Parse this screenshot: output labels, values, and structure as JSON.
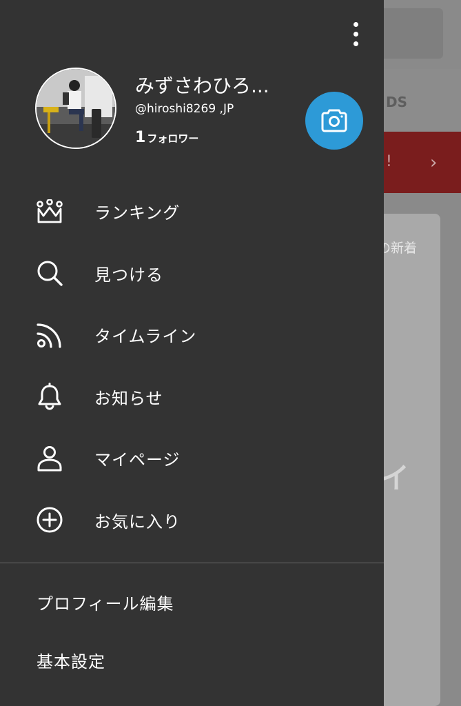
{
  "background": {
    "tab_label": "DS",
    "banner_text": "!",
    "card_text": "の新着",
    "card_big_text": "イ"
  },
  "drawer": {
    "user": {
      "name": "みずさわひろ...",
      "handle": "@hiroshi8269 ,JP",
      "follower_count": "1",
      "follower_label": "フォロワー"
    },
    "menu": [
      {
        "label": "ランキング",
        "icon": "crown-icon"
      },
      {
        "label": "見つける",
        "icon": "search-icon"
      },
      {
        "label": "タイムライン",
        "icon": "rss-feed-icon"
      },
      {
        "label": "お知らせ",
        "icon": "bell-icon"
      },
      {
        "label": "マイページ",
        "icon": "person-icon"
      },
      {
        "label": "お気に入り",
        "icon": "add-circle-icon"
      }
    ],
    "sub_menu": [
      {
        "label": "プロフィール編集"
      },
      {
        "label": "基本設定"
      }
    ]
  },
  "colors": {
    "drawer_bg": "#333333",
    "accent": "#2d9ad7",
    "banner": "#c62828"
  }
}
